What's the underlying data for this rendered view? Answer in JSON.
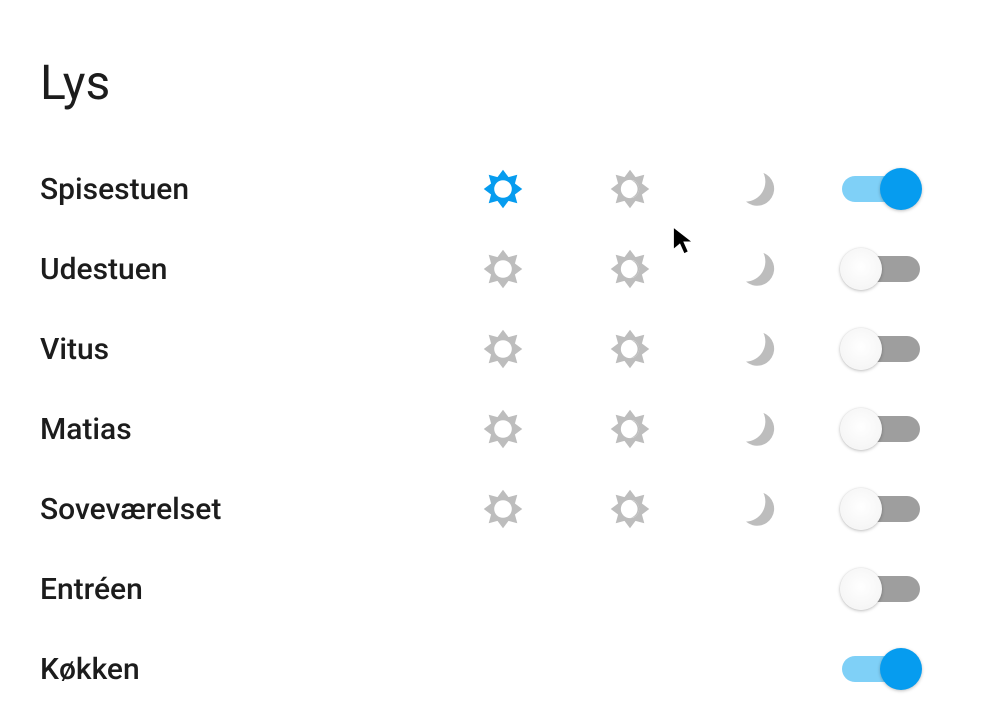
{
  "title": "Lys",
  "colors": {
    "accent": "#069cef",
    "icon_inactive": "#bdbdbd",
    "track_off": "#9e9e9e",
    "track_on": "#7fd0f7"
  },
  "rows": [
    {
      "label": "Spisestuen",
      "has_modes": true,
      "bright_active": true,
      "on": true
    },
    {
      "label": "Udestuen",
      "has_modes": true,
      "bright_active": false,
      "on": false
    },
    {
      "label": "Vitus",
      "has_modes": true,
      "bright_active": false,
      "on": false
    },
    {
      "label": "Matias",
      "has_modes": true,
      "bright_active": false,
      "on": false
    },
    {
      "label": "Soveværelset",
      "has_modes": true,
      "bright_active": false,
      "on": false
    },
    {
      "label": "Entréen",
      "has_modes": false,
      "bright_active": false,
      "on": false
    },
    {
      "label": "Køkken",
      "has_modes": false,
      "bright_active": false,
      "on": true
    }
  ]
}
